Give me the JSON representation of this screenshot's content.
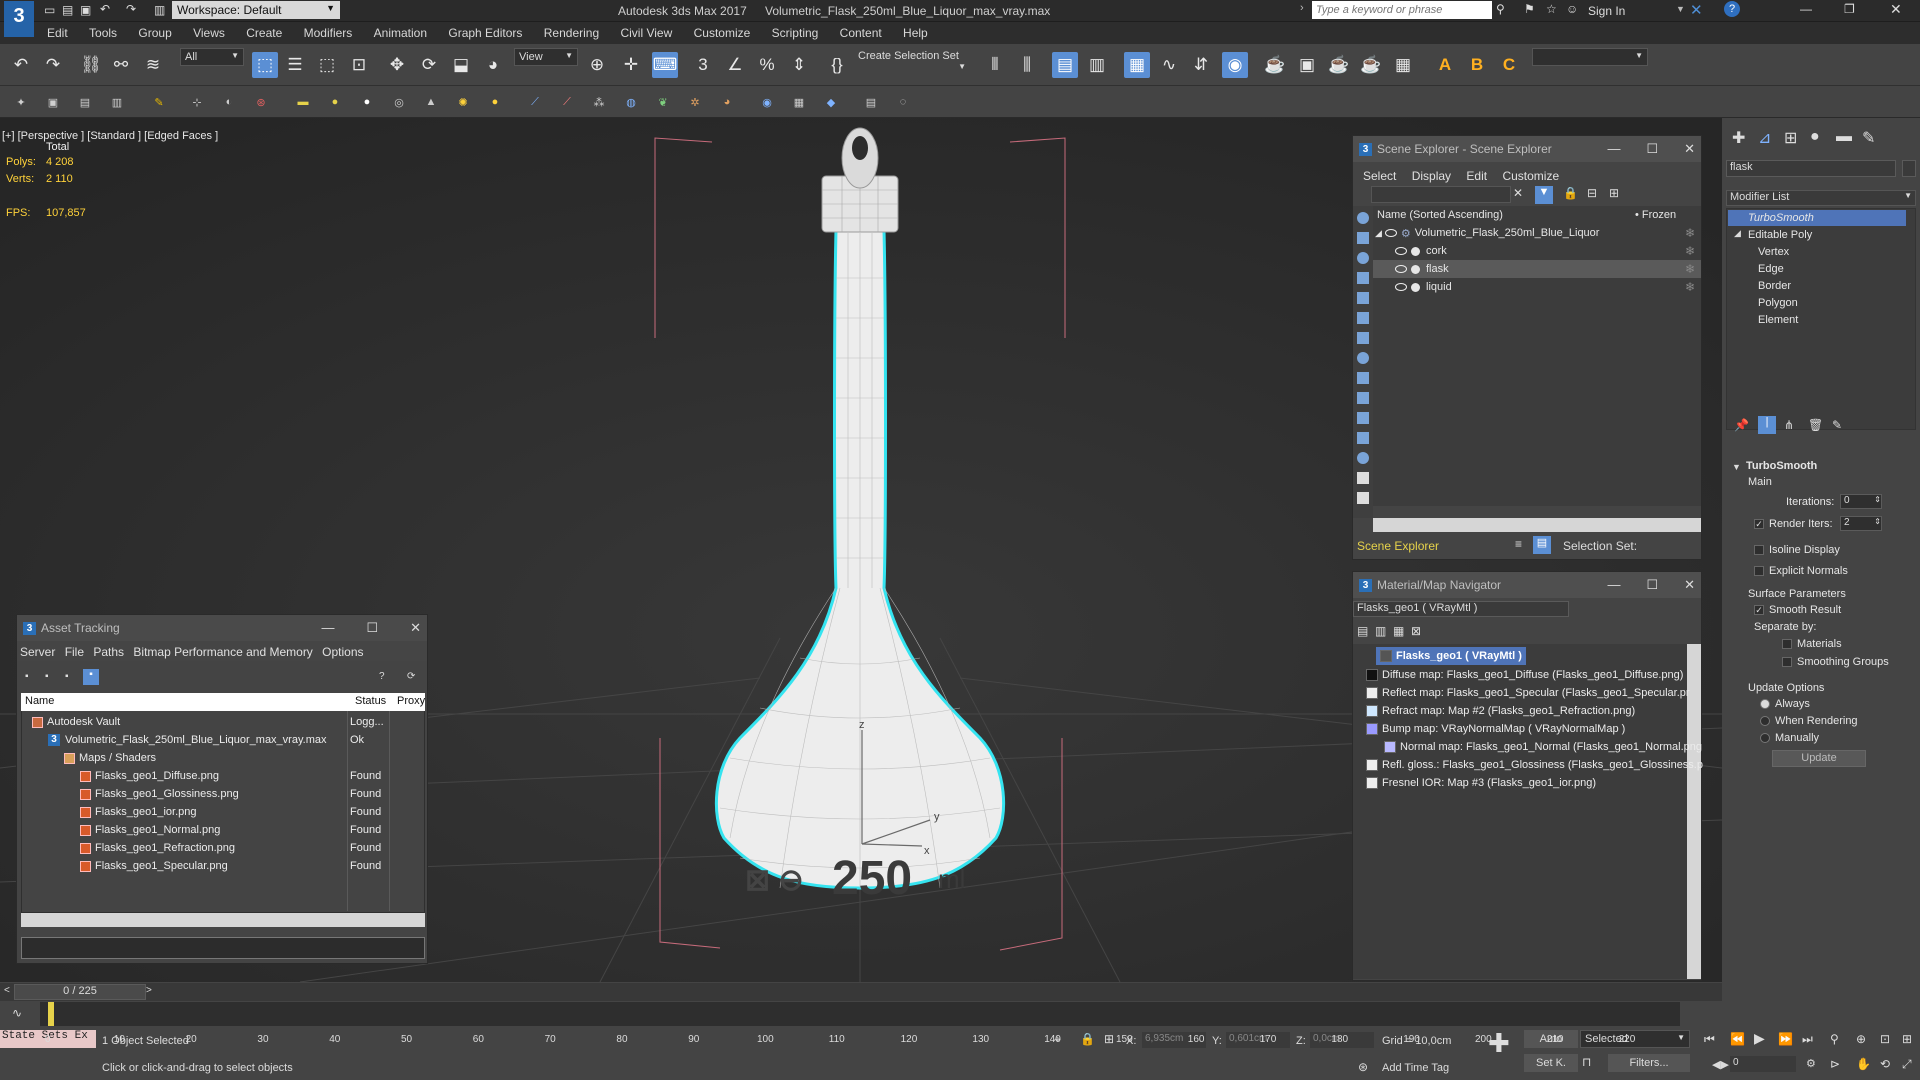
{
  "titlebar": {
    "workspace": "Workspace: Default",
    "app_title": "Autodesk 3ds Max 2017",
    "file_name": "Volumetric_Flask_250ml_Blue_Liquor_max_vray.max",
    "search_placeholder": "Type a keyword or phrase",
    "sign_in": "Sign In"
  },
  "menu": [
    "Edit",
    "Tools",
    "Group",
    "Views",
    "Create",
    "Modifiers",
    "Animation",
    "Graph Editors",
    "Rendering",
    "Civil View",
    "Customize",
    "Scripting",
    "Content",
    "Help"
  ],
  "toolbar": {
    "filter_value": "All",
    "view_value": "View",
    "selection_set": "Create Selection Set"
  },
  "viewport": {
    "label": "[+] [Perspective ] [Standard ] [Edged Faces ]",
    "stats_header": "Total",
    "polys_label": "Polys:",
    "polys_value": "4 208",
    "verts_label": "Verts:",
    "verts_value": "2 110",
    "fps_label": "FPS:",
    "fps_value": "107,857",
    "axis_x": "x",
    "axis_y": "y",
    "axis_z": "z",
    "flask_text": "250",
    "flask_unit": "ml"
  },
  "scene_explorer": {
    "title": "Scene Explorer - Scene Explorer",
    "menu": [
      "Select",
      "Display",
      "Edit",
      "Customize"
    ],
    "col_name": "Name (Sorted Ascending)",
    "col_frozen": "• Frozen",
    "root": "Volumetric_Flask_250ml_Blue_Liquor",
    "children": [
      "cork",
      "flask",
      "liquid"
    ],
    "footer_label": "Scene Explorer",
    "selection_set_label": "Selection Set:"
  },
  "material_nav": {
    "title": "Material/Map Navigator",
    "material_field": "Flasks_geo1  ( VRayMtl )",
    "root": "Flasks_geo1  ( VRayMtl )",
    "maps": [
      "Diffuse map: Flasks_geo1_Diffuse (Flasks_geo1_Diffuse.png)",
      "Reflect map: Flasks_geo1_Specular (Flasks_geo1_Specular.pr",
      "Refract map: Map #2 (Flasks_geo1_Refraction.png)",
      "Bump map: VRayNormalMap  ( VRayNormalMap )",
      "Normal map: Flasks_geo1_Normal (Flasks_geo1_Normal.png",
      "Refl. gloss.: Flasks_geo1_Glossiness (Flasks_geo1_Glossiness.p",
      "Fresnel IOR: Map #3 (Flasks_geo1_ior.png)"
    ]
  },
  "asset_tracking": {
    "title": "Asset Tracking",
    "menu": [
      "Server",
      "File",
      "Paths",
      "Bitmap Performance and Memory",
      "Options"
    ],
    "col_name": "Name",
    "col_status": "Status",
    "col_proxy": "Proxy",
    "rows": [
      {
        "name": "Autodesk Vault",
        "status": "Logg...",
        "indent": 0
      },
      {
        "name": "Volumetric_Flask_250ml_Blue_Liquor_max_vray.max",
        "status": "Ok",
        "indent": 1
      },
      {
        "name": "Maps / Shaders",
        "status": "",
        "indent": 2
      },
      {
        "name": "Flasks_geo1_Diffuse.png",
        "status": "Found",
        "indent": 3
      },
      {
        "name": "Flasks_geo1_Glossiness.png",
        "status": "Found",
        "indent": 3
      },
      {
        "name": "Flasks_geo1_ior.png",
        "status": "Found",
        "indent": 3
      },
      {
        "name": "Flasks_geo1_Normal.png",
        "status": "Found",
        "indent": 3
      },
      {
        "name": "Flasks_geo1_Refraction.png",
        "status": "Found",
        "indent": 3
      },
      {
        "name": "Flasks_geo1_Specular.png",
        "status": "Found",
        "indent": 3
      }
    ]
  },
  "command_panel": {
    "search_value": "flask",
    "modifier_list": "Modifier List",
    "stack": [
      "TurboSmooth",
      "Editable Poly",
      "Vertex",
      "Edge",
      "Border",
      "Polygon",
      "Element"
    ],
    "rollout_title": "TurboSmooth",
    "main_label": "Main",
    "iterations_label": "Iterations:",
    "iterations_value": "0",
    "render_iters_label": "Render Iters:",
    "render_iters_value": "2",
    "isoline": "Isoline Display",
    "explicit_normals": "Explicit Normals",
    "surface_params": "Surface Parameters",
    "smooth_result": "Smooth Result",
    "separate_by": "Separate by:",
    "materials": "Materials",
    "smoothing_groups": "Smoothing Groups",
    "update_options": "Update Options",
    "always": "Always",
    "when_rendering": "When Rendering",
    "manually": "Manually",
    "update_button": "Update"
  },
  "timeline": {
    "frame_counter": "0 / 225",
    "ticks": [
      "0",
      "10",
      "20",
      "30",
      "40",
      "50",
      "60",
      "70",
      "80",
      "90",
      "100",
      "110",
      "120",
      "130",
      "140",
      "150",
      "160",
      "170",
      "180",
      "190",
      "200",
      "210",
      "220"
    ],
    "progress": 0
  },
  "status": {
    "state_sets": "State Sets Ex",
    "selected": "1 Object Selected",
    "prompt": "Click or click-and-drag to select objects",
    "x_label": "X:",
    "x_value": "6,935cm",
    "y_label": "Y:",
    "y_value": "0,601cm",
    "z_label": "Z:",
    "z_value": "0,0cm",
    "grid": "Grid = 10,0cm",
    "add_time_tag": "Add Time Tag",
    "auto": "Auto",
    "selected_dd": "Selected",
    "set_k": "Set K.",
    "filters": "Filters...",
    "frame_field": "0"
  },
  "colors": {
    "accent_blue": "#4f8fd6",
    "selection_cyan": "#35e4f0",
    "stats_yellow": "#ffd23a",
    "asset_orange": "#d85a2a"
  }
}
